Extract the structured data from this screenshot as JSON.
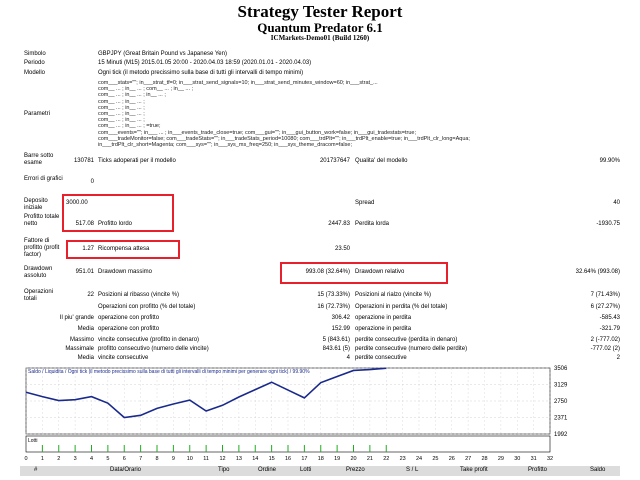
{
  "header": {
    "title": "Strategy Tester Report",
    "subtitle": "Quantum Predator 6.1",
    "server": "ICMarkets-Demo01 (Build 1260)"
  },
  "info": {
    "symbol_label": "Simbolo",
    "symbol_value": "GBPJPY (Great Britain Pound vs Japanese Yen)",
    "period_label": "Periodo",
    "period_value": "15 Minuti (M15) 2015.01.05 20:00 - 2020.04.03 18:59 (2020.01.01 - 2020.04.03)",
    "model_label": "Modello",
    "model_value": "Ogni tick (il metodo precissimo sulla base di tutti gli intervalli di tempo minimi)",
    "params_label": "Parametri",
    "params_lines": [
      "com___stats=\"\"; in___strat_tf=0; in___strat_send_signals=10; in___strat_send_minutes_window=60; in___strat_...",
      "com__ ... ; in__ ... ; com__ ... ; in__ ... ;",
      "com__ ... ; in__ ... ; in__ ... ;",
      "com__ ... ; in__ ... ;",
      "com__ ... ; in__ ... ;",
      "com__ ... ; in__ ... ;",
      "com__ ... ; in__ ... ;",
      "com__ ... ; in__ ... ; =true;",
      "com___events=\"\"; in___ ... ; in___events_trade_close=true; com___gui=\"\"; in___gui_button_work=false; in___gui_tradestats=true;",
      "com___tradeMonitor=false; com___tradeStats=\"\"; in___tradeStats_period=10080; com___trdPlt=\"\"; in___trdPlt_enable=true; in___trdPlt_clr_long=Aqua;",
      "in___trdPlt_clr_short=Magenta; com___sys=\"\"; in___sys_ms_freq=250; in___sys_theme_dracom=false;"
    ]
  },
  "stats": {
    "bars_label": "Barre sotto esame",
    "bars_value": "130781",
    "ticks_label": "Ticks adoperati per il modello",
    "ticks_value": "201737647",
    "quality_label": "Qualita' del modello",
    "quality_value": "99.90%",
    "errors_label": "Errori di grafici",
    "errors_value": "0",
    "deposit_label": "Deposito iniziale",
    "deposit_value": "3000.00",
    "spread_label": "Spread",
    "spread_value": "40",
    "profit_label": "Profitto totale netto",
    "profit_value": "517.08",
    "gross_profit_label": "Profitto lordo",
    "gross_profit_value": "2447.83",
    "gross_loss_label": "Perdita lorda",
    "gross_loss_value": "-1930.75",
    "pf_label": "Fattore di profitto (profit factor)",
    "pf_value": "1.27",
    "payoff_label": "Ricompensa attesa",
    "payoff_value": "23.50",
    "dd_label": "Drawdown assoluto",
    "dd_value": "951.01",
    "maxdd_label": "Drawdown massimo",
    "maxdd_value": "993.08 (32.64%)",
    "reldd_label": "Drawdown relativo",
    "reldd_value": "32.64% (993.08)",
    "ops_label": "Operazioni totali",
    "ops_value": "22",
    "short_label": "Posizioni al ribasso (vincite %)",
    "short_value": "15 (73.33%)",
    "long_label": "Posizioni al rialzo (vincite %)",
    "long_value": "7 (71.43%)",
    "win_label": "Operazioni con profitto (% del totale)",
    "win_value": "16 (72.73%)",
    "loss_label": "Operazioni in perdita (% del totale)",
    "loss_value": "6 (27.27%)",
    "best_prefix": "Il piu' grande",
    "best_label": "operazione con profitto",
    "best_value": "306.42",
    "worst_label": "operazione in perdita",
    "worst_value": "-585.43",
    "avg_prefix": "Media",
    "avg_win_label": "operazione con profitto",
    "avg_win_value": "152.99",
    "avg_loss_label": "operazione in perdita",
    "avg_loss_value": "-321.79",
    "max_prefix": "Massimo",
    "maxcw_label": "vincite consecutive (profitto in denaro)",
    "maxcw_value": "5 (843.61)",
    "maxcl_label": "perdite consecutive (perdita in denaro)",
    "maxcl_value": "2 (-777.02)",
    "maxm_prefix": "Massimale",
    "maxpc_label": "profitto consecutivo (numero delle vincite)",
    "maxpc_value": "843.61 (5)",
    "maxlc_label": "perdite consecutive (numero delle perdite)",
    "maxlc_value": "-777.02 (2)",
    "med_prefix": "Media",
    "avgcw_label": "vincite consecutive",
    "avgcw_value": "4",
    "avgcl_label": "perdite consecutive",
    "avgcl_value": "2"
  },
  "chart_data": {
    "type": "line",
    "title": "Saldo / Liquidita / Ogni tick (il metodo precissimo sulla base di tutti gli intervalli di tempo minimi per generare ogni tick) / 99.90%",
    "legend": [
      "Saldo",
      "Liquidita"
    ],
    "x": [
      0,
      1,
      2,
      3,
      4,
      5,
      6,
      7,
      8,
      9,
      10,
      11,
      12,
      13,
      14,
      15,
      16,
      17,
      18,
      19,
      20,
      21,
      22
    ],
    "values": [
      2950,
      2850,
      2760,
      2780,
      2850,
      2700,
      2370,
      2420,
      2580,
      2680,
      2770,
      2520,
      2650,
      2840,
      3010,
      3180,
      3000,
      2820,
      3170,
      3310,
      3450,
      3470,
      3500
    ],
    "ylim": [
      1992,
      3506
    ],
    "yticks": [
      "3506",
      "3129",
      "2750",
      "2371",
      "1992"
    ],
    "xticks": [
      "0",
      "1",
      "2",
      "3",
      "4",
      "5",
      "6",
      "7",
      "8",
      "9",
      "10",
      "11",
      "12",
      "13",
      "14",
      "15",
      "16",
      "17",
      "18",
      "19",
      "20",
      "21",
      "22",
      "23",
      "24",
      "25",
      "26",
      "27",
      "28",
      "29",
      "30",
      "31",
      "32"
    ],
    "lots_label": "Lotti",
    "lots": [
      0,
      1,
      1,
      1,
      1,
      1,
      1,
      1,
      1,
      1,
      1,
      1,
      1,
      1,
      1,
      1,
      1,
      1,
      1,
      1,
      1,
      1,
      1
    ],
    "colors": {
      "line": "#1a2a8c",
      "lots": "#22aa22",
      "grid": "#c8c8c8",
      "frame": "#000000"
    }
  },
  "table_header": [
    "#",
    "Data/Orario",
    "Tipo",
    "Ordine",
    "Lotti",
    "Prezzo",
    "S / L",
    "Take profit",
    "Profitto",
    "Saldo"
  ]
}
